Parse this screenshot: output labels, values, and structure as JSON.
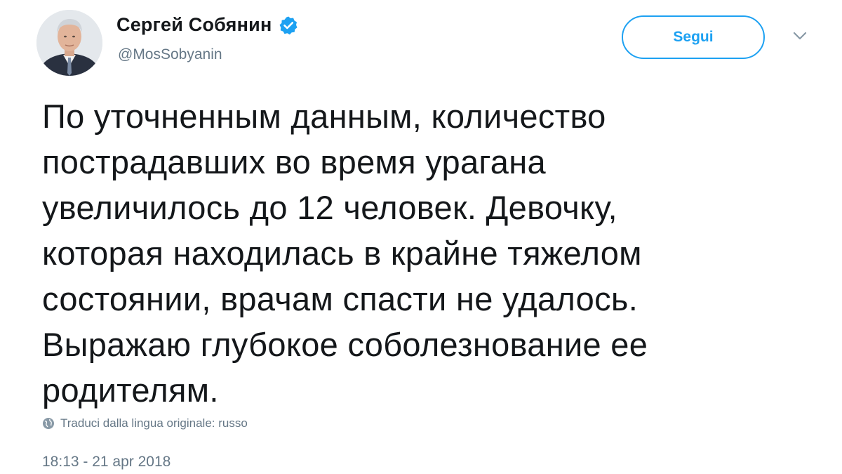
{
  "user": {
    "display_name": "Сергей Собянин",
    "handle": "@MosSobyanin",
    "verified": true,
    "avatar_icon": "avatar-photo"
  },
  "actions": {
    "follow_label": "Segui",
    "menu_icon": "chevron-down-icon"
  },
  "tweet": {
    "text": "По уточненным данным, количество\nпострадавших во время урагана\nувеличилось до 12 человек. Девочку,\nкоторая находилась в крайне тяжелом\nсостоянии, врачам спасти не удалось.\nВыражаю глубокое соболезнование ее\nродителям.",
    "translate_label": "Traduci dalla lingua originale: russo",
    "translate_icon": "globe-icon",
    "timestamp": "18:13 - 21 apr 2018"
  },
  "colors": {
    "accent": "#1da1f2",
    "text_primary": "#14171a",
    "text_secondary": "#657786"
  }
}
